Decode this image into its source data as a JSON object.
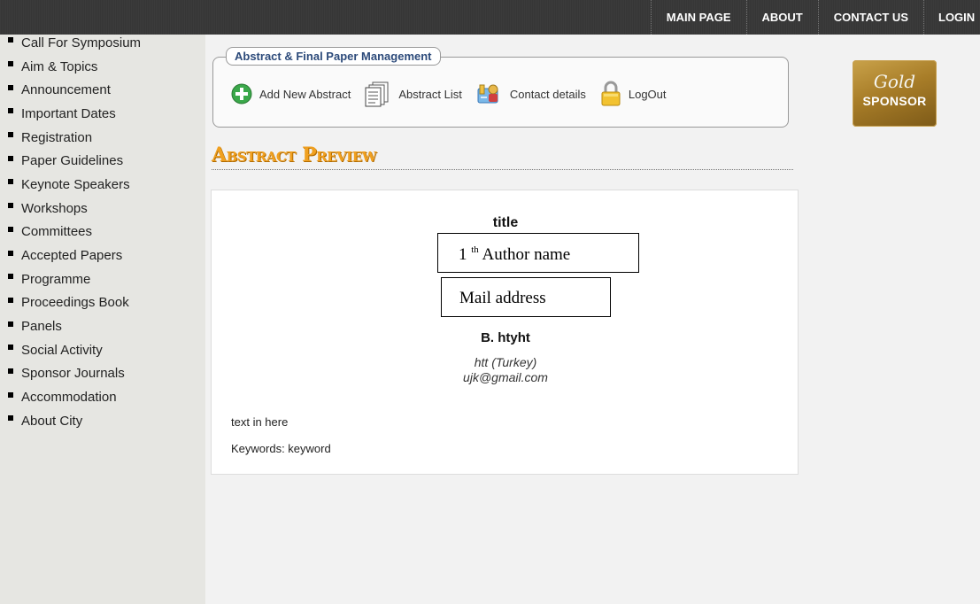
{
  "nav": {
    "items": [
      "MAIN PAGE",
      "ABOUT",
      "CONTACT US",
      "LOGIN"
    ]
  },
  "sidebar": {
    "items": [
      "Call For Symposium",
      "Aim & Topics",
      "Announcement",
      "Important Dates",
      "Registration",
      "Paper Guidelines",
      "Keynote Speakers",
      "Workshops",
      "Committees",
      "Accepted Papers",
      "Programme",
      "Proceedings Book",
      "Panels",
      "Social Activity",
      "Sponsor Journals",
      "Accommodation",
      "About City"
    ]
  },
  "management": {
    "title": "Abstract & Final Paper Management",
    "links": {
      "add": "Add New Abstract",
      "list": "Abstract List",
      "contact": "Contact details",
      "logout": "LogOut"
    }
  },
  "preview": {
    "heading": "Abstract Preview",
    "title": "title",
    "author_box_num": "1",
    "author_box_sup": "th",
    "author_box_text": "Author name",
    "mail_box_text": "Mail address",
    "author_name": "B. htyht",
    "affiliation": "htt (Turkey)",
    "email": "ujk@gmail.com",
    "body": "text in here",
    "keywords": "Keywords: keyword"
  },
  "sponsor": {
    "line1": "Gold",
    "line2": "SPONSOR"
  },
  "colors": {
    "topbar": "#3a3a3a",
    "heading_accent": "#f0a020",
    "sponsor_gold": "#a87d28"
  }
}
